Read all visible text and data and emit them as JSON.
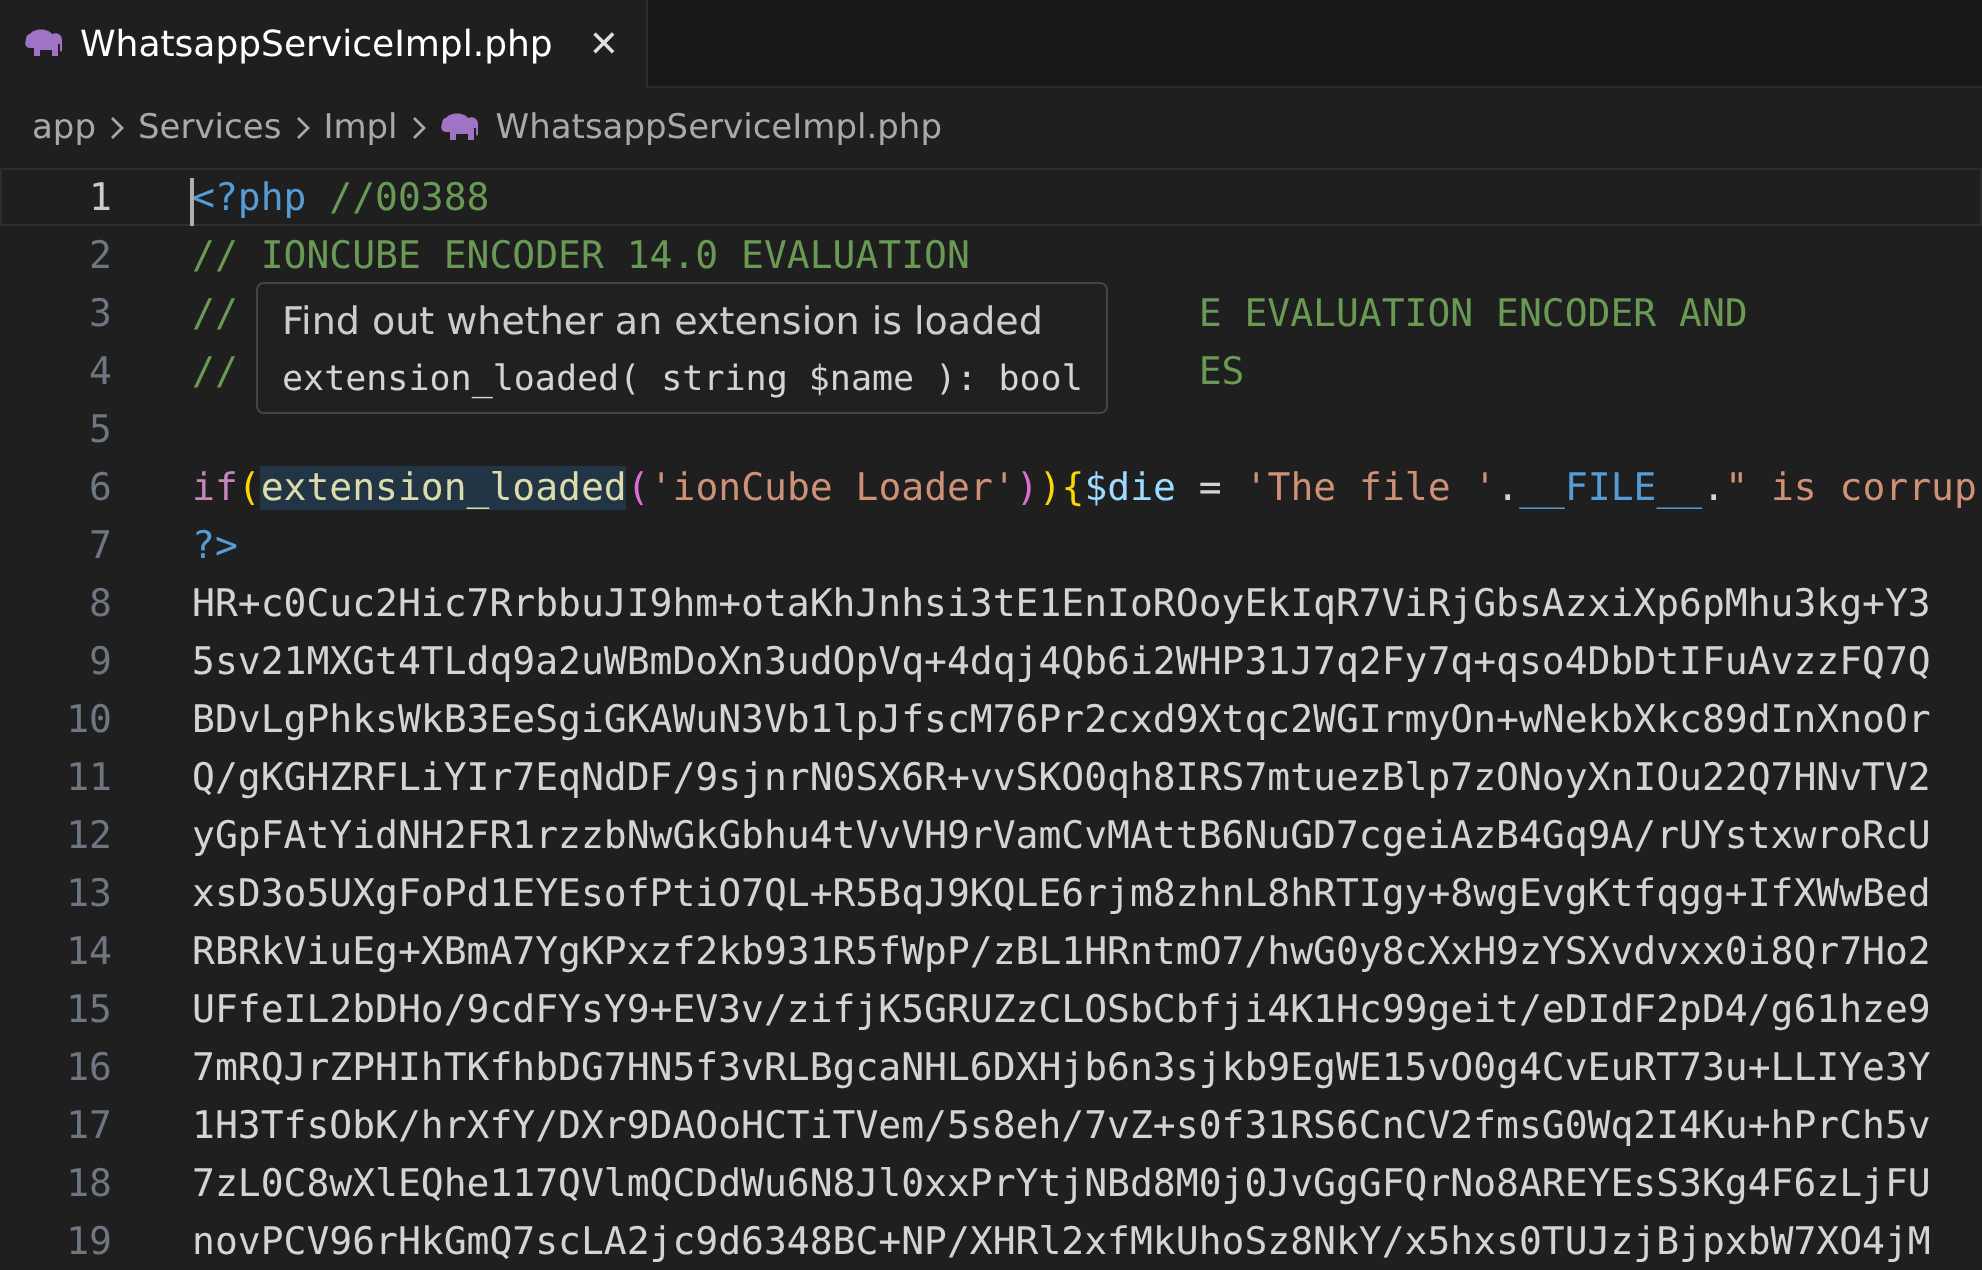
{
  "tabs": [
    {
      "label": "WhatsappServiceImpl.php",
      "selected": true,
      "close": "✕"
    }
  ],
  "breadcrumb": [
    {
      "label": "app",
      "kind": "folder"
    },
    {
      "label": "Services",
      "kind": "folder"
    },
    {
      "label": "Impl",
      "kind": "folder"
    },
    {
      "label": "WhatsappServiceImpl.php",
      "kind": "file"
    }
  ],
  "editor": {
    "lines": [
      {
        "number": "1",
        "current": true,
        "tokens": [
          {
            "text": "<?php",
            "kind": "tag"
          },
          {
            "text": " //00388",
            "kind": "comment"
          }
        ]
      },
      {
        "number": "2",
        "current": false,
        "tokens": [
          {
            "text": "// IONCUBE ENCODER 14.0 EVALUATION",
            "kind": "comment"
          }
        ]
      },
      {
        "number": "3",
        "current": false,
        "tokens": [
          {
            "text": "//",
            "kind": "comment"
          },
          {
            "text": "E EVALUATION ENCODER AND",
            "kind": "comment_after_gap"
          }
        ]
      },
      {
        "number": "4",
        "current": false,
        "tokens": [
          {
            "text": "//",
            "kind": "comment"
          },
          {
            "text": "ES",
            "kind": "comment_after_gap"
          }
        ]
      },
      {
        "number": "5",
        "current": false
      },
      {
        "number": "6",
        "current": false,
        "tokens": [
          {
            "text": "if",
            "kind": "keyword"
          },
          {
            "text": "(",
            "kind": "bracket1"
          },
          {
            "text": "extension_loaded",
            "kind": "hovered_function"
          },
          {
            "text": "(",
            "kind": "bracket2"
          },
          {
            "text": "'ionCube Loader'",
            "kind": "string"
          },
          {
            "text": ")",
            "kind": "bracket2"
          },
          {
            "text": ")",
            "kind": "bracket1"
          },
          {
            "text": "{",
            "kind": "bracket1"
          },
          {
            "text": "$die",
            "kind": "variable"
          },
          {
            "text": " = ",
            "kind": "plain"
          },
          {
            "text": "'The file '",
            "kind": "string"
          },
          {
            "text": ".",
            "kind": "plain"
          },
          {
            "text": "__FILE__",
            "kind": "constant"
          },
          {
            "text": ".",
            "kind": "plain"
          },
          {
            "text": "\" is corrup",
            "kind": "string"
          }
        ]
      },
      {
        "number": "7",
        "current": false,
        "tokens": [
          {
            "text": "?>",
            "kind": "tag"
          }
        ]
      },
      {
        "number": "8",
        "current": false,
        "tokens": [
          {
            "text": "HR+c0Cuc2Hic7RrbbuJI9hm+otaKhJnhsi3tE1EnIoROoyEkIqR7ViRjGbsAzxiXp6pMhu3kg+Y3",
            "kind": "plain"
          }
        ]
      },
      {
        "number": "9",
        "current": false,
        "tokens": [
          {
            "text": "5sv21MXGt4TLdq9a2uWBmDoXn3udOpVq+4dqj4Qb6i2WHP31J7q2Fy7q+qso4DbDtIFuAvzzFQ7Q",
            "kind": "plain"
          }
        ]
      },
      {
        "number": "10",
        "current": false,
        "tokens": [
          {
            "text": "BDvLgPhksWkB3EeSgiGKAWuN3Vb1lpJfscM76Pr2cxd9Xtqc2WGIrmyOn+wNekbXkc89dInXnoOr",
            "kind": "plain"
          }
        ]
      },
      {
        "number": "11",
        "current": false,
        "tokens": [
          {
            "text": "Q/gKGHZRFLiYIr7EqNdDF/9sjnrN0SX6R+vvSKO0qh8IRS7mtuezBlp7zONoyXnIOu22Q7HNvTV2",
            "kind": "plain"
          }
        ]
      },
      {
        "number": "12",
        "current": false,
        "tokens": [
          {
            "text": "yGpFAtYidNH2FR1rzzbNwGkGbhu4tVvVH9rVamCvMAttB6NuGD7cgeiAzB4Gq9A/rUYstxwroRcU",
            "kind": "plain"
          }
        ]
      },
      {
        "number": "13",
        "current": false,
        "tokens": [
          {
            "text": "xsD3o5UXgFoPd1EYEsofPtiO7QL+R5BqJ9KQLE6rjm8zhnL8hRTIgy+8wgEvgKtfqgg+IfXWwBed",
            "kind": "plain"
          }
        ]
      },
      {
        "number": "14",
        "current": false,
        "tokens": [
          {
            "text": "RBRkViuEg+XBmA7YgKPxzf2kb931R5fWpP/zBL1HRntmO7/hwG0y8cXxH9zYSXvdvxx0i8Qr7Ho2",
            "kind": "plain"
          }
        ]
      },
      {
        "number": "15",
        "current": false,
        "tokens": [
          {
            "text": "UFfeIL2bDHo/9cdFYsY9+EV3v/zifjK5GRUZzCLOSbCbfji4K1Hc99geit/eDIdF2pD4/g61hze9",
            "kind": "plain"
          }
        ]
      },
      {
        "number": "16",
        "current": false,
        "tokens": [
          {
            "text": "7mRQJrZPHIhTKfhbDG7HN5f3vRLBgcaNHL6DXHjb6n3sjkb9EgWE15vO0g4CvEuRT73u+LLIYe3Y",
            "kind": "plain"
          }
        ]
      },
      {
        "number": "17",
        "current": false,
        "tokens": [
          {
            "text": "1H3TfsObK/hrXfY/DXr9DAOoHCTiTVem/5s8eh/7vZ+s0f31RS6CnCV2fmsG0Wq2I4Ku+hPrCh5v",
            "kind": "plain"
          }
        ]
      },
      {
        "number": "18",
        "current": false,
        "tokens": [
          {
            "text": "7zL0C8wXlEQhe117QVlmQCDdWu6N8Jl0xxPrYtjNBd8M0j0JvGgGFQrNo8AREYEsS3Kg4F6zLjFU",
            "kind": "plain"
          }
        ]
      },
      {
        "number": "19",
        "current": false,
        "tokens": [
          {
            "text": "novPCV96rHkGmQ7scLA2jc9d6348BC+NP/XHRl2xfMkUhoSz8NkY/x5hxs0TUJzjBjpxbW7XO4jM",
            "kind": "plain"
          }
        ]
      }
    ]
  },
  "hover": {
    "description": "Find out whether an extension is loaded",
    "signature": "extension_loaded( string $name ): bool"
  }
}
